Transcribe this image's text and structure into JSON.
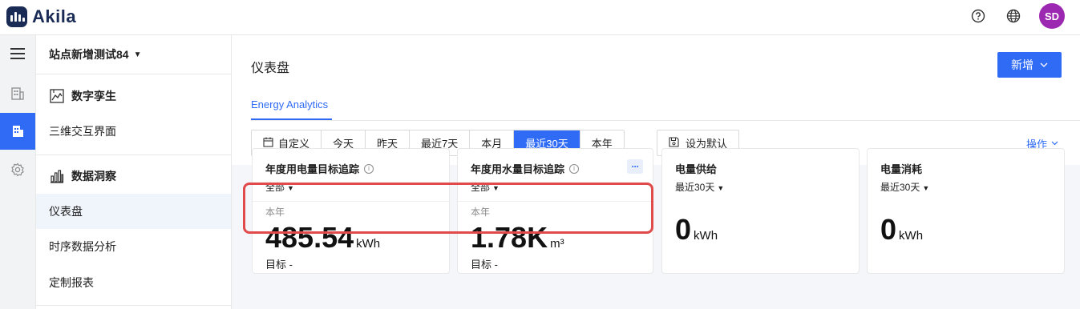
{
  "brand": {
    "name": "Akila",
    "logo_color": "#1a2b55"
  },
  "topbar": {
    "help_icon": "help-circle-icon",
    "lang_icon": "globe-icon",
    "avatar_initials": "SD",
    "avatar_color": "#9c27b0"
  },
  "rail": {
    "items": [
      {
        "icon": "menu-icon",
        "active": false
      },
      {
        "icon": "building-icon",
        "active": false
      },
      {
        "icon": "building-filled-icon",
        "active": true
      },
      {
        "icon": "settings-icon",
        "active": false
      }
    ]
  },
  "sidebar": {
    "site_name": "站点新增测试84",
    "groups": [
      {
        "label": "数字孪生",
        "icon": "digital-twin-icon",
        "items": [
          "三维交互界面"
        ]
      },
      {
        "label": "数据洞察",
        "icon": "bar-chart-icon",
        "items": [
          "仪表盘",
          "时序数据分析",
          "定制报表"
        ]
      }
    ],
    "active_item": "仪表盘"
  },
  "main": {
    "title": "仪表盘",
    "new_button": "新增",
    "tab": "Energy Analytics",
    "ranges": [
      "自定义",
      "今天",
      "昨天",
      "最近7天",
      "本月",
      "最近30天",
      "本年"
    ],
    "active_range": "最近30天",
    "set_default": "设为默认",
    "operations": "操作",
    "accent_color": "#2f6bf5"
  },
  "cards": [
    {
      "title": "年度用电量目标追踪",
      "filter": "全部",
      "period": "本年",
      "value": "485.54",
      "unit": "kWh",
      "target": "目标 -",
      "has_info": true,
      "has_more": false
    },
    {
      "title": "年度用水量目标追踪",
      "filter": "全部",
      "period": "本年",
      "value": "1.78K",
      "unit": "m³",
      "target": "目标 -",
      "has_info": true,
      "has_more": true
    },
    {
      "title": "电量供给",
      "filter": "最近30天",
      "value": "0",
      "unit": "kWh",
      "has_info": false,
      "has_more": false
    },
    {
      "title": "电量消耗",
      "filter": "最近30天",
      "value": "0",
      "unit": "kWh",
      "has_info": false,
      "has_more": false
    }
  ],
  "highlight_color": "#e14a4a"
}
